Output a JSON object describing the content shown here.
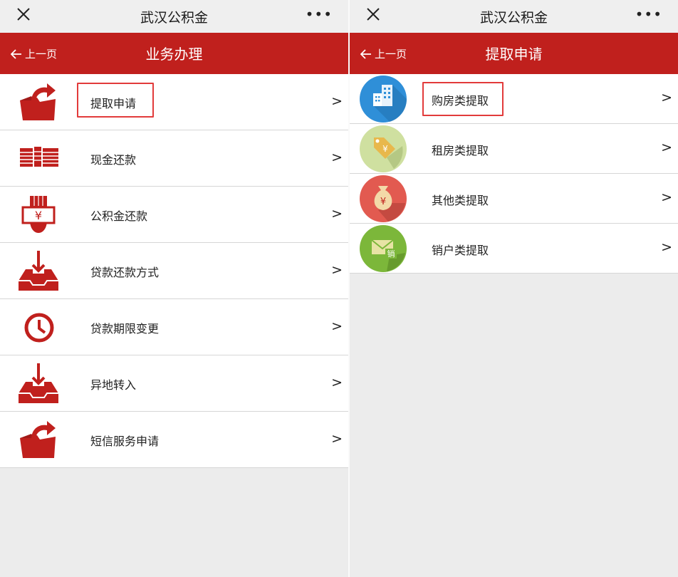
{
  "left": {
    "window_title": "武汉公积金",
    "back_label": "上一页",
    "nav_title": "业务办理",
    "items": [
      {
        "label": "提取申请",
        "icon": "folder-upload-icon"
      },
      {
        "label": "现金还款",
        "icon": "cash-stack-icon"
      },
      {
        "label": "公积金还款",
        "icon": "hand-yuan-icon"
      },
      {
        "label": "贷款还款方式",
        "icon": "inbox-download-icon"
      },
      {
        "label": "贷款期限变更",
        "icon": "clock-icon"
      },
      {
        "label": "异地转入",
        "icon": "inbox-download-icon"
      },
      {
        "label": "短信服务申请",
        "icon": "folder-upload-icon"
      }
    ],
    "arrow": ">"
  },
  "right": {
    "window_title": "武汉公积金",
    "back_label": "上一页",
    "nav_title": "提取申请",
    "items": [
      {
        "label": "购房类提取",
        "icon": "building-icon"
      },
      {
        "label": "租房类提取",
        "icon": "price-tag-icon"
      },
      {
        "label": "其他类提取",
        "icon": "money-bag-icon"
      },
      {
        "label": "销户类提取",
        "icon": "envelope-cancel-icon",
        "badge": "销"
      }
    ],
    "arrow": ">"
  },
  "more_glyph": "•••",
  "colors": {
    "brand_red": "#c0201d",
    "highlight": "#e23b3b"
  }
}
